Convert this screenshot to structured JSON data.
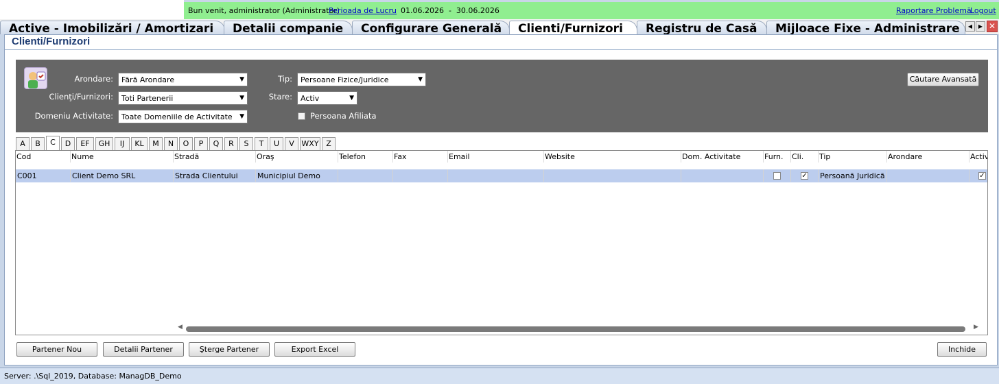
{
  "topbar": {
    "welcome": "Bun venit, administrator (Administrator)",
    "period_link": "Perioada de Lucru",
    "period_range": "01.06.2026  -  30.06.2026",
    "report_link": "Raportare Problemă",
    "logout_link": "Logout"
  },
  "tabs": [
    {
      "label": "Active - Imobilizări / Amortizari"
    },
    {
      "label": "Detalii companie"
    },
    {
      "label": "Configurare Generală"
    },
    {
      "label": "Clienti/Furnizori"
    },
    {
      "label": "Registru de Casă"
    },
    {
      "label": "Mijloace Fixe - Administrare"
    }
  ],
  "page": {
    "title": "Clienti/Furnizori"
  },
  "filters": {
    "arondare_label": "Arondare:",
    "arondare_value": "Fără Arondare",
    "clienti_label": "Clienţi/Furnizori:",
    "clienti_value": "Toti Partenerii",
    "domeniu_label": "Domeniu Activitate:",
    "domeniu_value": "Toate Domeniile de Activitate",
    "tip_label": "Tip:",
    "tip_value": "Persoane Fizice/Juridice",
    "stare_label": "Stare:",
    "stare_value": "Activ",
    "afiliata_label": "Persoana Afiliata",
    "advanced_search": "Căutare Avansată"
  },
  "letters": [
    "A",
    "B",
    "C",
    "D",
    "EF",
    "GH",
    "IJ",
    "KL",
    "M",
    "N",
    "O",
    "P",
    "Q",
    "R",
    "S",
    "T",
    "U",
    "V",
    "WXY",
    "Z"
  ],
  "active_letter": "C",
  "grid": {
    "columns": [
      "Cod",
      "Nume",
      "Stradă",
      "Oraş",
      "Telefon",
      "Fax",
      "Email",
      "Website",
      "Dom. Activitate",
      "Furn.",
      "Cli.",
      "Tip",
      "Arondare",
      "Activ"
    ],
    "rows": [
      {
        "cod": "C001",
        "nume": "Client Demo SRL",
        "strada": "Strada Clientului",
        "oras": "Municipiul Demo",
        "telefon": "",
        "fax": "",
        "email": "",
        "website": "",
        "dom": "",
        "furn": false,
        "cli": true,
        "tip": "Persoană Juridică",
        "arondare": "",
        "activ": true
      }
    ]
  },
  "buttons": {
    "new_partner": "Partener Nou",
    "partner_details": "Detalii Partener",
    "delete_partner": "Şterge Partener",
    "export_excel": "Export Excel",
    "close": "Inchide"
  },
  "status": {
    "text": "Server: .\\Sql_2019, Database: ManagDB_Demo"
  },
  "colors": {
    "topbar_green": "#90ee90",
    "filter_panel": "#666666",
    "selected_row": "#bccdee",
    "title_blue": "#1f3d73"
  }
}
